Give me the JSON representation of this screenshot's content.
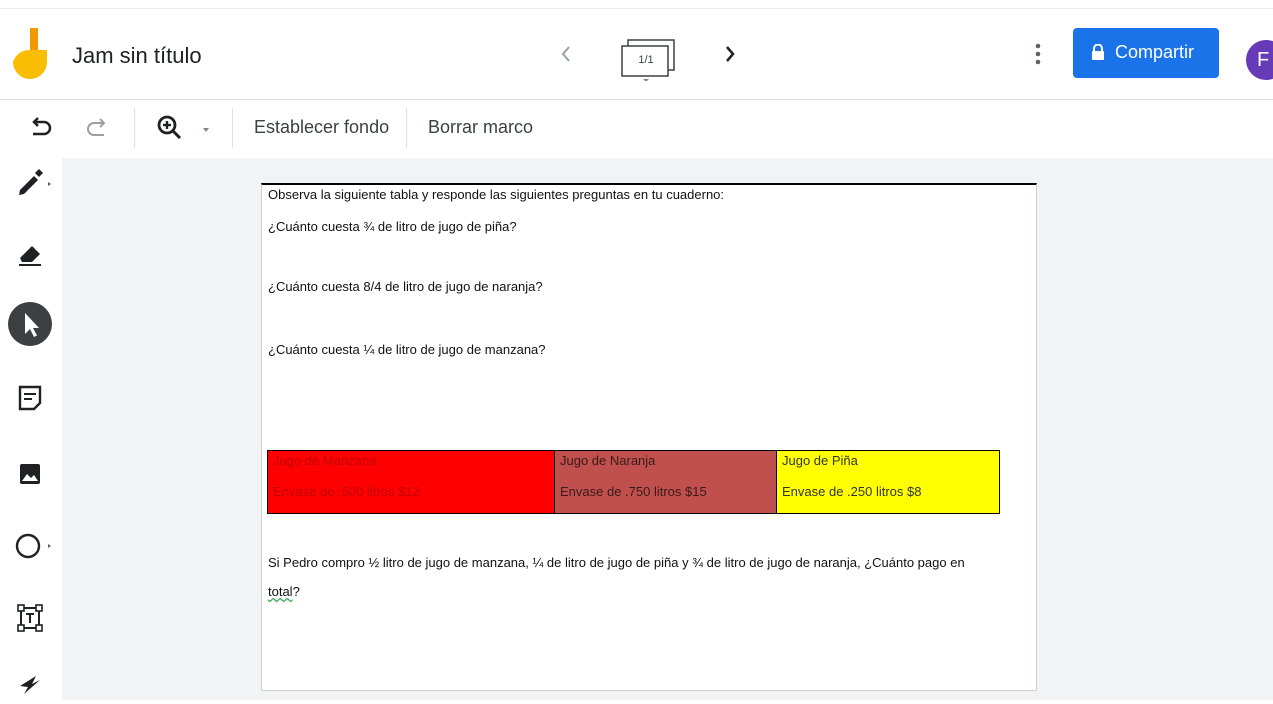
{
  "app": {
    "title": "Jam sin título",
    "frame_indicator": "1/1",
    "share_label": "Compartir",
    "avatar_initial": "F",
    "colors": {
      "accent": "#1a73e8",
      "avatar": "#673ab7",
      "logo_yellow": "#fbbc04",
      "logo_orange": "#f29900"
    }
  },
  "toolbar": {
    "undo_icon": "undo-icon",
    "redo_icon": "redo-icon",
    "zoom_icon": "zoom-in-icon",
    "set_background": "Establecer fondo",
    "clear_frame": "Borrar marco"
  },
  "sidebar": {
    "tools": [
      "pen-icon",
      "eraser-icon",
      "select-cursor-icon",
      "sticky-note-icon",
      "image-icon",
      "circle-shape-icon",
      "text-box-icon",
      "laser-pointer-icon"
    ]
  },
  "document": {
    "intro": "Observa la siguiente tabla y responde las siguientes preguntas en tu cuaderno:",
    "questions": [
      "¿Cuánto cuesta ¾ de litro de jugo de piña?",
      "¿Cuánto cuesta 8/4 de litro de jugo de naranja?",
      "¿Cuánto cuesta ¼ de litro de jugo de manzana?"
    ],
    "table": [
      {
        "header": "Jugo de Manzana",
        "value": "Envase de .500 litros $12",
        "bg": "#ff0000",
        "fg": "#c00000"
      },
      {
        "header": "Jugo de Naranja",
        "value": "Envase de .750 litros $15",
        "bg": "#c0504d",
        "fg": "#3a1a1a"
      },
      {
        "header": "Jugo de Piña",
        "value": "Envase de .250 litros $8",
        "bg": "#ffff00",
        "fg": "#333333"
      }
    ],
    "final_question": "Si Pedro compro ½ litro de jugo de manzana, ¼ de litro de jugo de piña y ¾ de litro de jugo de naranja, ¿Cuánto pago en",
    "final_question_end": "total",
    "final_question_mark": "?"
  }
}
